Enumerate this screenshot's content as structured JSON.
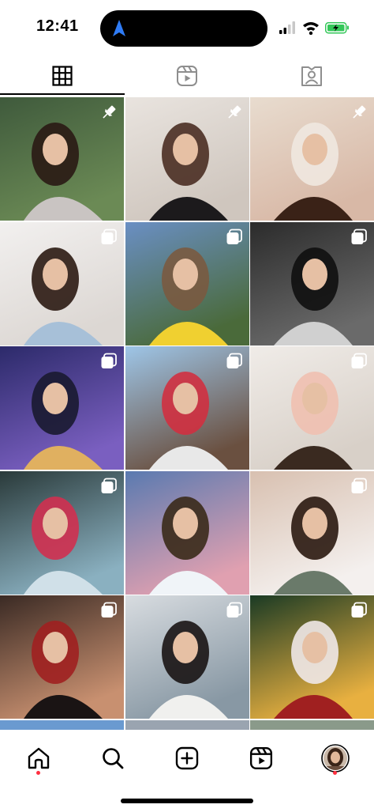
{
  "status_bar": {
    "time": "12:41",
    "battery_color": "#34c759"
  },
  "tabs": [
    {
      "name": "posts-grid",
      "icon": "grid-icon",
      "selected": true
    },
    {
      "name": "reels",
      "icon": "reels-icon",
      "selected": false
    },
    {
      "name": "tagged",
      "icon": "tagged-user-icon",
      "selected": false
    }
  ],
  "grid": {
    "posts": [
      {
        "badge": "pin-icon",
        "palette": [
          "#3f5a3c",
          "#6b8a55",
          "#c9c4c2",
          "#2a1a14"
        ]
      },
      {
        "badge": "pin-icon",
        "palette": [
          "#e9e4df",
          "#cfc6be",
          "#1c1a1c",
          "#4a2e22"
        ]
      },
      {
        "badge": "pin-icon",
        "palette": [
          "#e8dccf",
          "#d8b8a6",
          "#3a2217",
          "#f0e8e0"
        ]
      },
      {
        "badge": "carousel-icon",
        "palette": [
          "#f2f0ef",
          "#dcd7d3",
          "#a7c0d8",
          "#2b1a12"
        ]
      },
      {
        "badge": "carousel-icon",
        "palette": [
          "#6a8fc4",
          "#4a6a3a",
          "#f0d030",
          "#7a5a40"
        ]
      },
      {
        "badge": "carousel-icon",
        "palette": [
          "#2b2b2b",
          "#6a6a6a",
          "#d0d0d0",
          "#101010"
        ]
      },
      {
        "badge": "carousel-icon",
        "palette": [
          "#2c2a6a",
          "#7a5fc0",
          "#e0b060",
          "#1a1a30"
        ]
      },
      {
        "badge": "carousel-icon",
        "palette": [
          "#9ec6e8",
          "#6a5040",
          "#e8e8e8",
          "#d03040"
        ]
      },
      {
        "badge": "carousel-icon",
        "palette": [
          "#f0ece8",
          "#d8d0c8",
          "#3a2a20",
          "#f0c0b0"
        ]
      },
      {
        "badge": "carousel-icon",
        "palette": [
          "#2a3a3a",
          "#8ab0c0",
          "#d0e0e8",
          "#d03050"
        ]
      },
      {
        "badge": "none",
        "palette": [
          "#5a7ab0",
          "#e0a0b0",
          "#f0f4f8",
          "#3a2a1a"
        ]
      },
      {
        "badge": "carousel-icon",
        "palette": [
          "#d8c0b0",
          "#f4f0ee",
          "#6a7a6a",
          "#2a1810"
        ]
      },
      {
        "badge": "carousel-icon",
        "palette": [
          "#3a2a24",
          "#c89070",
          "#1a1414",
          "#a02020"
        ]
      },
      {
        "badge": "carousel-icon",
        "palette": [
          "#d8dce0",
          "#8898a4",
          "#f0f0ee",
          "#1a1414"
        ]
      },
      {
        "badge": "carousel-icon",
        "palette": [
          "#1a3a24",
          "#e8b040",
          "#a02020",
          "#f0e8e8"
        ]
      }
    ]
  },
  "bottom_nav": {
    "items": [
      {
        "name": "home",
        "icon": "home-icon",
        "has_dot": true
      },
      {
        "name": "search",
        "icon": "search-icon",
        "has_dot": false
      },
      {
        "name": "create",
        "icon": "plus-square-icon",
        "has_dot": false
      },
      {
        "name": "reels",
        "icon": "reels-icon",
        "has_dot": false
      },
      {
        "name": "profile",
        "icon": "avatar",
        "has_dot": true
      }
    ],
    "notification_dot_color": "#ff3040"
  }
}
